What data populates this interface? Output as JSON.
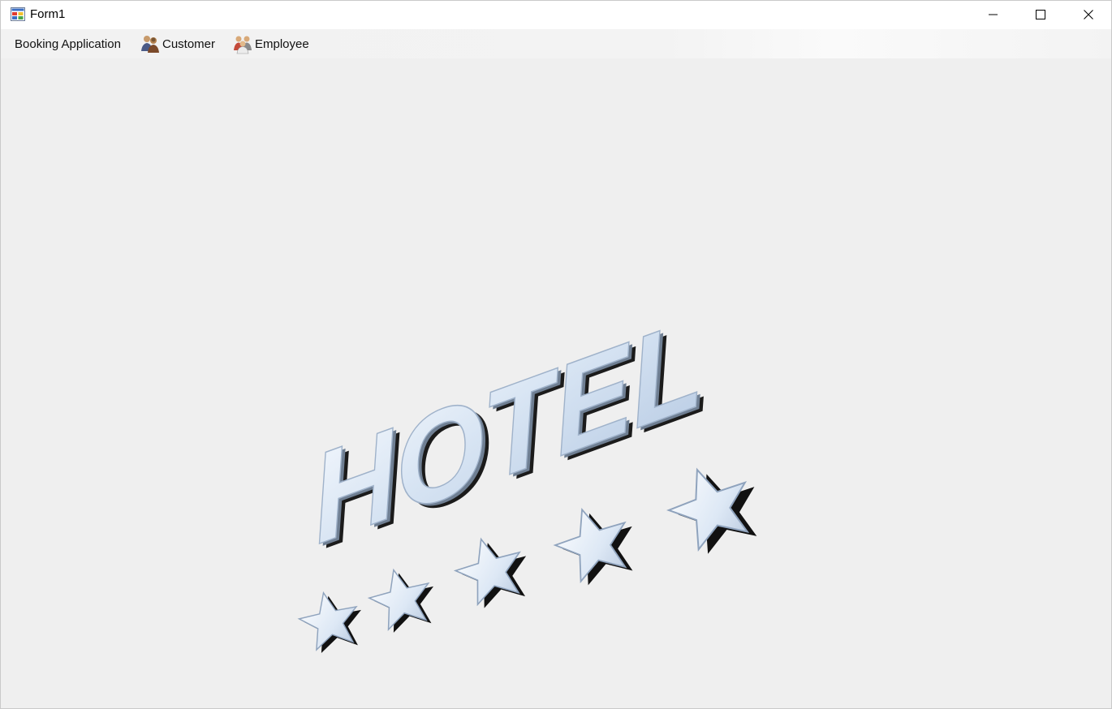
{
  "window": {
    "title": "Form1",
    "controls": {
      "minimize_icon": "minimize-icon",
      "maximize_icon": "maximize-icon",
      "close_icon": "close-icon"
    }
  },
  "menu": {
    "items": [
      {
        "label": "Booking Application",
        "icon": null
      },
      {
        "label": "Customer",
        "icon": "customers-icon"
      },
      {
        "label": "Employee",
        "icon": "employees-icon"
      }
    ]
  },
  "background_image": {
    "text": "HOTEL",
    "stars": 5,
    "colors": {
      "letter_face": "#dfe9f6",
      "letter_shadow": "#1b1b1b",
      "background": "#efefef"
    }
  }
}
